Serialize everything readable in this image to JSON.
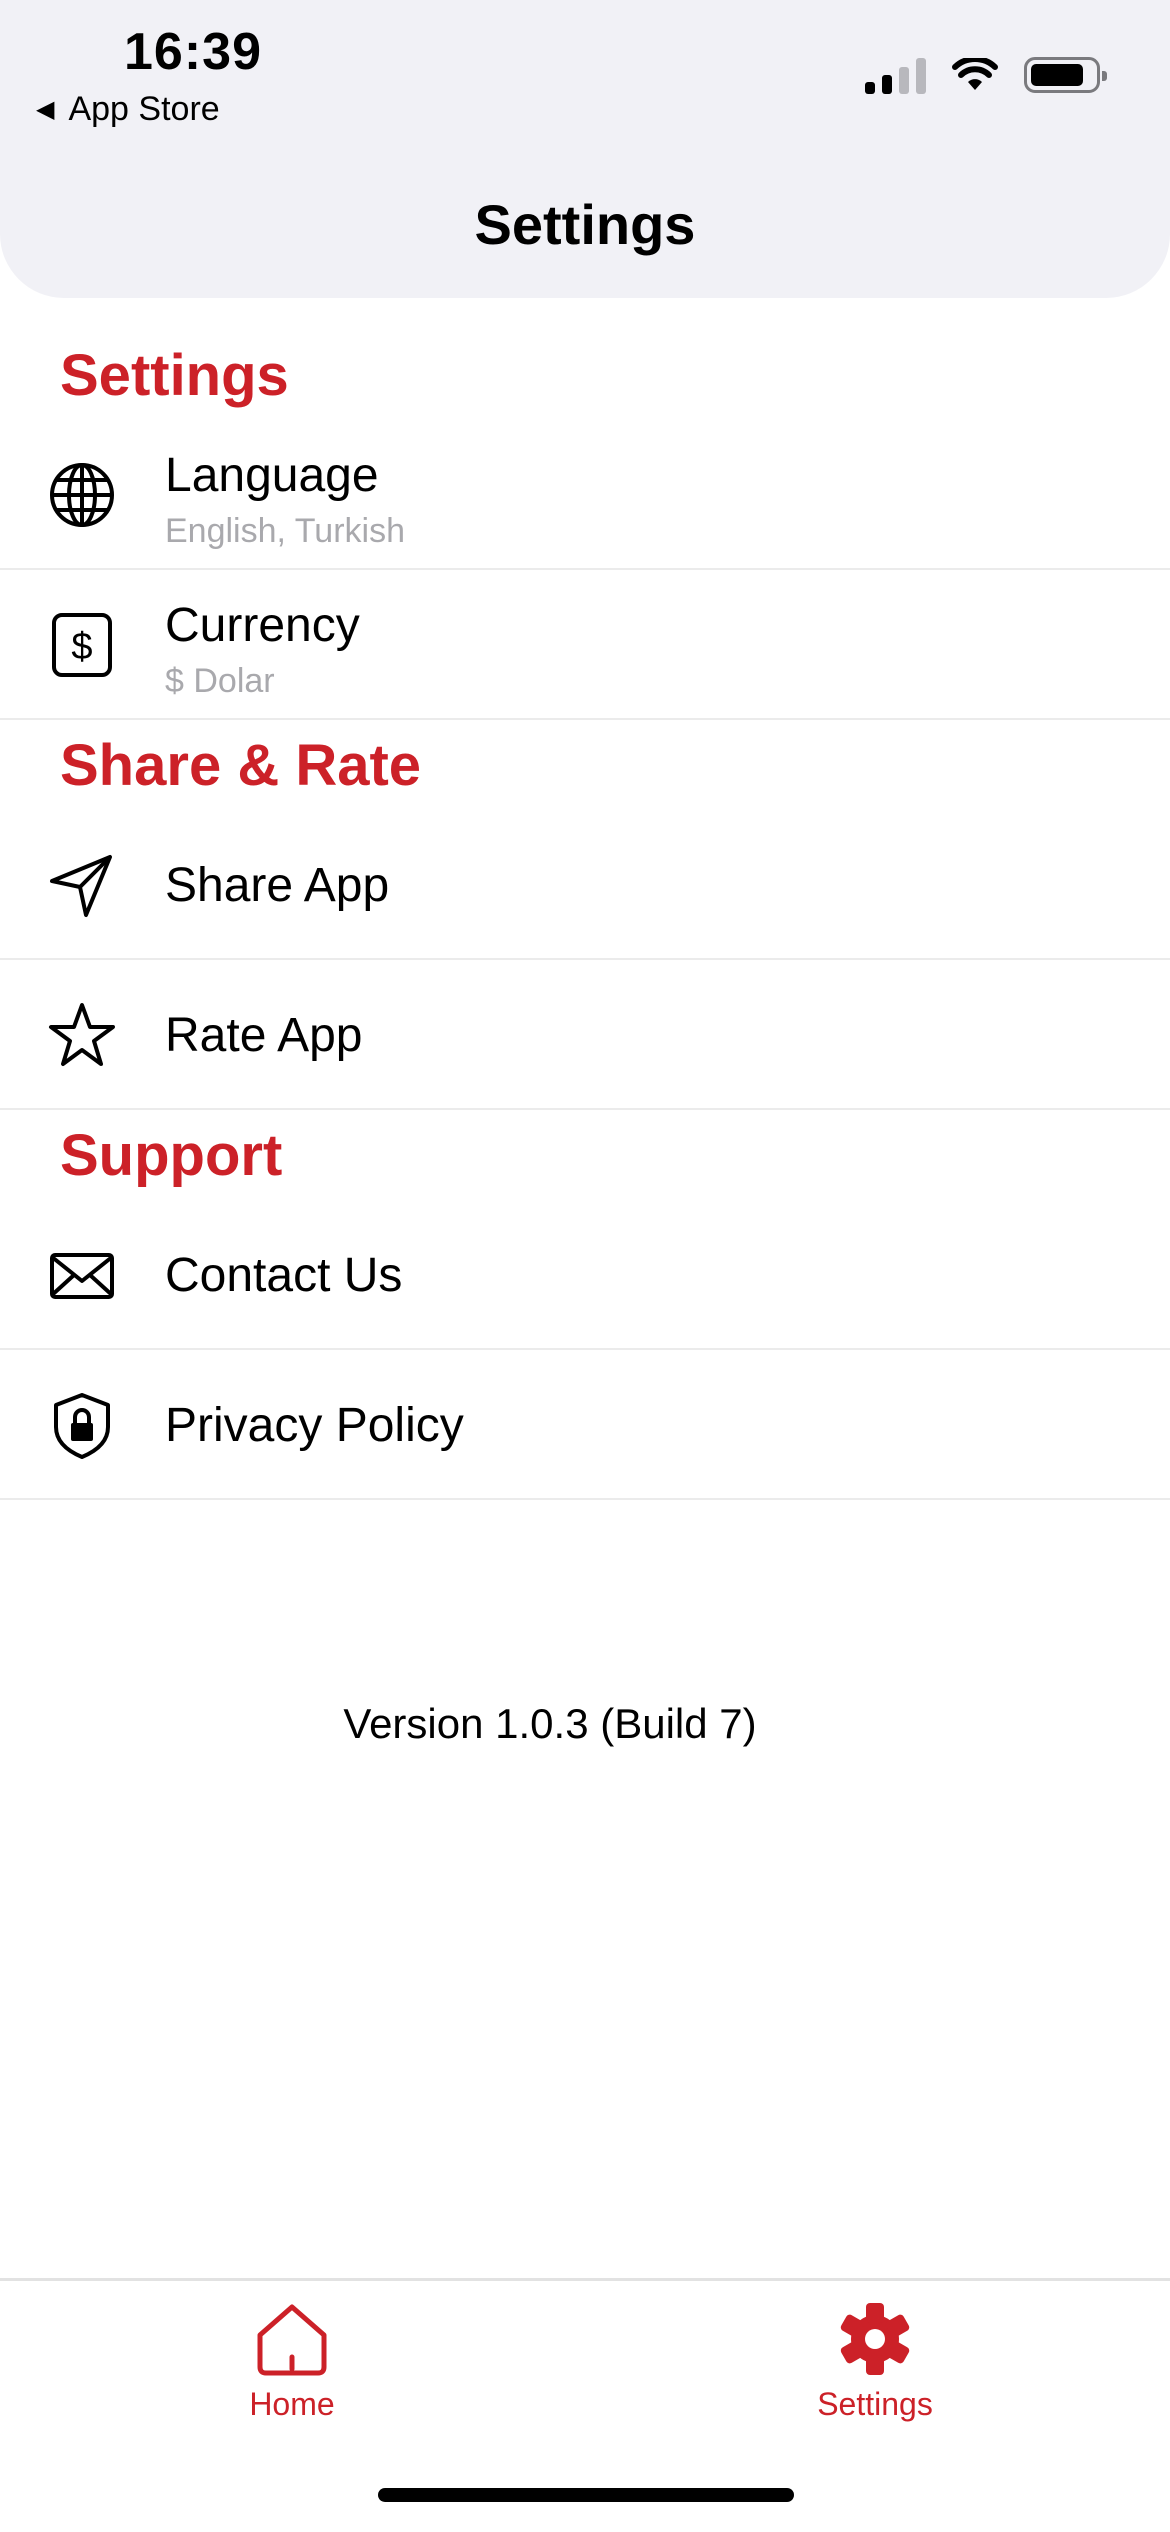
{
  "status_bar": {
    "time": "16:39",
    "back_label": "App Store"
  },
  "nav": {
    "title": "Settings"
  },
  "sections": {
    "settings": {
      "title": "Settings",
      "language": {
        "label": "Language",
        "sub": "English, Turkish",
        "icon": "globe-icon"
      },
      "currency": {
        "label": "Currency",
        "sub": "$ Dolar",
        "icon": "dollar-icon"
      }
    },
    "share_rate": {
      "title": "Share & Rate",
      "share": {
        "label": "Share App",
        "icon": "paper-plane-icon"
      },
      "rate": {
        "label": "Rate App",
        "icon": "star-icon"
      }
    },
    "support": {
      "title": "Support",
      "contact": {
        "label": "Contact Us",
        "icon": "envelope-icon"
      },
      "privacy": {
        "label": "Privacy Policy",
        "icon": "shield-lock-icon"
      }
    }
  },
  "version": "Version 1.0.3 (Build 7)",
  "tabbar": {
    "home": {
      "label": "Home",
      "icon": "home-icon"
    },
    "settings": {
      "label": "Settings",
      "icon": "gear-icon"
    }
  },
  "colors": {
    "accent": "#cc2128",
    "header_bg": "#f1f1f6",
    "subtitle": "#a9a9ad"
  }
}
